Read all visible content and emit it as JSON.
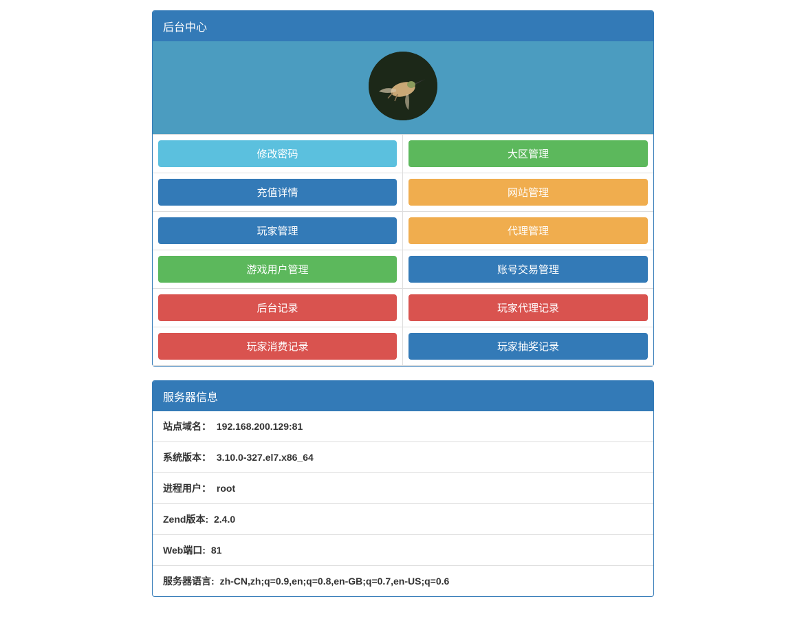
{
  "panel1": {
    "title": "后台中心"
  },
  "buttons": {
    "b0": "修改密码",
    "b1": "大区管理",
    "b2": "充值详情",
    "b3": "网站管理",
    "b4": "玩家管理",
    "b5": "代理管理",
    "b6": "游戏用户管理",
    "b7": "账号交易管理",
    "b8": "后台记录",
    "b9": "玩家代理记录",
    "b10": "玩家消费记录",
    "b11": "玩家抽奖记录"
  },
  "panel2": {
    "title": "服务器信息"
  },
  "info": {
    "domain_label": "站点域名：",
    "domain_value": "192.168.200.129:81",
    "system_label": "系统版本：",
    "system_value": "3.10.0-327.el7.x86_64",
    "user_label": "进程用户：",
    "user_value": "root",
    "zend_label": "Zend版本:",
    "zend_value": "2.4.0",
    "port_label": "Web端口:",
    "port_value": "81",
    "lang_label": "服务器语言:",
    "lang_value": "zh-CN,zh;q=0.9,en;q=0.8,en-GB;q=0.7,en-US;q=0.6"
  }
}
